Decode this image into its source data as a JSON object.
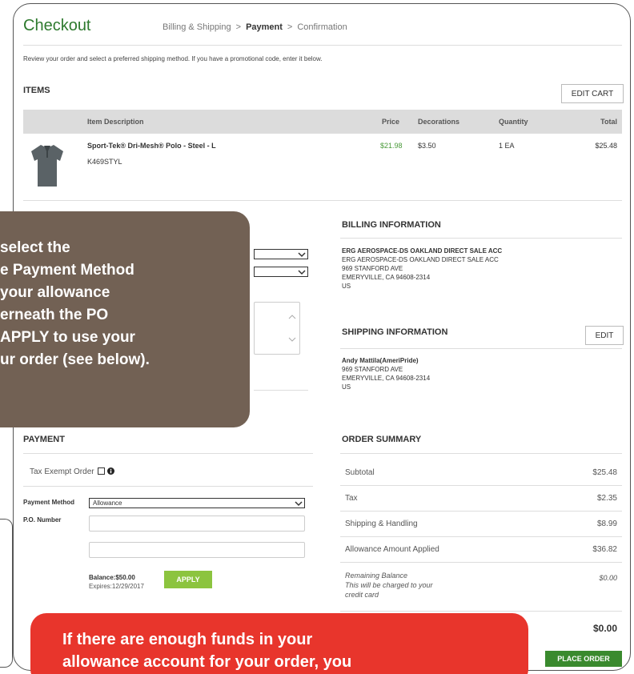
{
  "header": {
    "title": "Checkout",
    "steps": [
      "Billing & Shipping",
      "Payment",
      "Confirmation"
    ],
    "separator": ">"
  },
  "intro": "Review your order and select a preferred shipping method. If you have a promotional code, enter it below.",
  "items": {
    "heading": "ITEMS",
    "edit_cart": "EDIT CART",
    "columns": [
      "Item Description",
      "Price",
      "Decorations",
      "Quantity",
      "Total"
    ],
    "rows": [
      {
        "name": "Sport-Tek® Dri-Mesh® Polo - Steel - L",
        "sku": "K469STYL",
        "price": "$21.98",
        "decorations": "$3.50",
        "quantity": "1 EA",
        "total": "$25.48"
      }
    ]
  },
  "billing": {
    "heading": "BILLING INFORMATION",
    "lines": [
      "ERG AEROSPACE-DS OAKLAND DIRECT SALE ACC",
      "ERG AEROSPACE-DS OAKLAND DIRECT SALE ACC",
      "969 STANFORD AVE",
      "EMERYVILLE, CA 94608-2314",
      "US"
    ]
  },
  "shipping": {
    "heading": "SHIPPING INFORMATION",
    "edit": "EDIT",
    "lines": [
      "Andy Mattila(AmeriPride)",
      "969 STANFORD AVE",
      "EMERYVILLE, CA 94608-2314",
      "US"
    ]
  },
  "payment": {
    "heading": "PAYMENT",
    "tax_exempt_label": "Tax Exempt Order",
    "method_label": "Payment Method",
    "method_value": "Allowance",
    "po_label": "P.O. Number",
    "balance": "Balance:$50.00",
    "expires": "Expires:12/29/2017",
    "apply": "APPLY"
  },
  "summary": {
    "heading": "ORDER SUMMARY",
    "rows": [
      {
        "label": "Subtotal",
        "value": "$25.48"
      },
      {
        "label": "Tax",
        "value": "$2.35"
      },
      {
        "label": "Shipping & Handling",
        "value": "$8.99"
      },
      {
        "label": "Allowance Amount Applied",
        "value": "$36.82"
      }
    ],
    "remaining_label": "Remaining Balance",
    "remaining_note_1": "This will be charged to your",
    "remaining_note_2": "credit card",
    "remaining_value": "$0.00",
    "total": "$0.00",
    "place_order": "PLACE ORDER"
  },
  "callout_top": {
    "lines": [
      " select the",
      "e Payment Method",
      "your allowance",
      "erneath the PO",
      "APPLY to use your",
      "ur order (see below)."
    ]
  },
  "callout_bottom": {
    "lines": [
      "If there are enough funds in your",
      "allowance account for your order, you"
    ]
  },
  "colors": {
    "brand_green": "#2e7a2e",
    "apply_green": "#8cc43f",
    "callout_brown": "#726154",
    "callout_red": "#e8352c"
  }
}
